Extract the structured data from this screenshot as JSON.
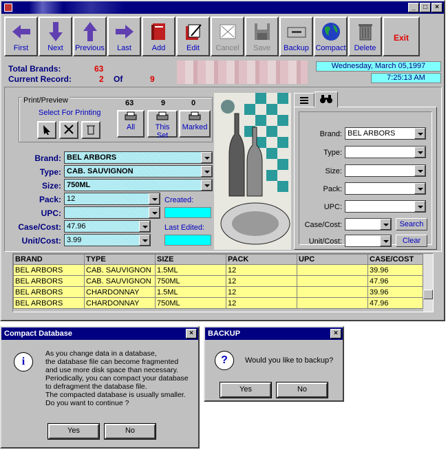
{
  "toolbar": {
    "first": "First",
    "next": "Next",
    "previous": "Previous",
    "last": "Last",
    "add": "Add",
    "edit": "Edit",
    "cancel": "Cancel",
    "save": "Save",
    "backup": "Backup",
    "compact": "Compact",
    "delete": "Delete",
    "exit": "Exit"
  },
  "stats": {
    "total_brands_label": "Total Brands:",
    "total_brands_value": "63",
    "current_record_label": "Current Record:",
    "current_record_value": "2",
    "of_label": "Of",
    "of_value": "9"
  },
  "datetime": {
    "date": "Wednesday, March 05,1997",
    "time": "7:25:13 AM"
  },
  "print": {
    "group_title": "Print/Preview",
    "select_label": "Select For Printing",
    "count_all": "63",
    "count_set": "9",
    "count_marked": "0",
    "all_label": "All",
    "set_label": "This Set",
    "marked_label": "Marked"
  },
  "form": {
    "brand_label": "Brand:",
    "brand_value": "BEL ARBORS",
    "type_label": "Type:",
    "type_value": "CAB. SAUVIGNON",
    "size_label": "Size:",
    "size_value": "750ML",
    "pack_label": "Pack:",
    "pack_value": "12",
    "upc_label": "UPC:",
    "upc_value": "",
    "casecost_label": "Case/Cost:",
    "casecost_value": "47.96",
    "unitcost_label": "Unit/Cost:",
    "unitcost_value": "3.99",
    "created_label": "Created:",
    "last_edited_label": "Last Edited:"
  },
  "search": {
    "brand_label": "Brand:",
    "brand_value": "BEL ARBORS",
    "type_label": "Type:",
    "size_label": "Size:",
    "pack_label": "Pack:",
    "upc_label": "UPC:",
    "casecost_label": "Case/Cost:",
    "unitcost_label": "Unit/Cost:",
    "search_button": "Search",
    "clear_button": "Clear"
  },
  "grid": {
    "headers": [
      "BRAND",
      "TYPE",
      "SIZE",
      "PACK",
      "UPC",
      "CASE/COST"
    ],
    "rows": [
      [
        "BEL ARBORS",
        "CAB. SAUVIGNON",
        "1.5ML",
        "12",
        "",
        "39.96"
      ],
      [
        "BEL ARBORS",
        "CAB. SAUVIGNON",
        "750ML",
        "12",
        "",
        "47.96"
      ],
      [
        "BEL ARBORS",
        "CHARDONNAY",
        "1.5ML",
        "12",
        "",
        "39.96"
      ],
      [
        "BEL ARBORS",
        "CHARDONNAY",
        "750ML",
        "12",
        "",
        "47.96"
      ]
    ]
  },
  "compact_dialog": {
    "title": "Compact Database",
    "lines": [
      "As you change data in a database,",
      "the database file can become fragmented",
      "and use more disk space than necessary.",
      "Periodically, you can compact your database",
      "to defragment the database file.",
      "The compacted database is usually smaller.",
      "Do you want to continue ?"
    ],
    "yes": "Yes",
    "no": "No",
    "close": "×"
  },
  "backup_dialog": {
    "title": "BACKUP",
    "message": "Would you like to backup?",
    "yes": "Yes",
    "no": "No",
    "close": "×"
  },
  "icons": {
    "info": "i",
    "question": "?"
  }
}
